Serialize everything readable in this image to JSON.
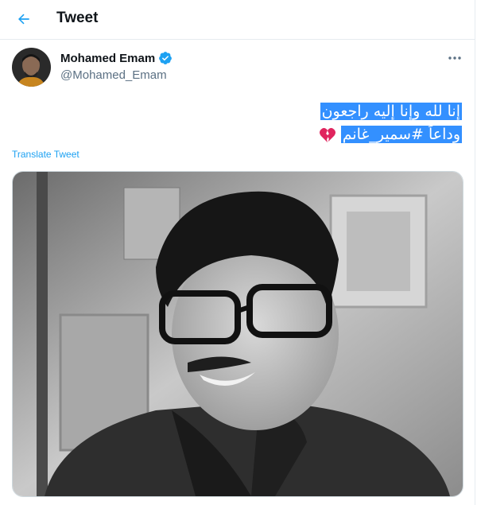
{
  "header": {
    "title": "Tweet",
    "back_icon": "arrow-left-icon"
  },
  "tweet": {
    "author_name": "Mohamed Emam",
    "author_handle": "@Mohamed_Emam",
    "verified_icon": "verified-badge-icon",
    "more_icon": "ellipsis-icon",
    "text_line1": "إنا لله وإنا إليه راجعون",
    "text_line2_word": "وداعاً",
    "hashtag": "#سمير_غانم",
    "emoji_icon": "broken-heart-icon",
    "translate_label": "Translate Tweet"
  },
  "colors": {
    "accent": "#1da1f2",
    "selection": "#3390ff",
    "muted": "#5b7083",
    "heart": "#e0245e"
  }
}
